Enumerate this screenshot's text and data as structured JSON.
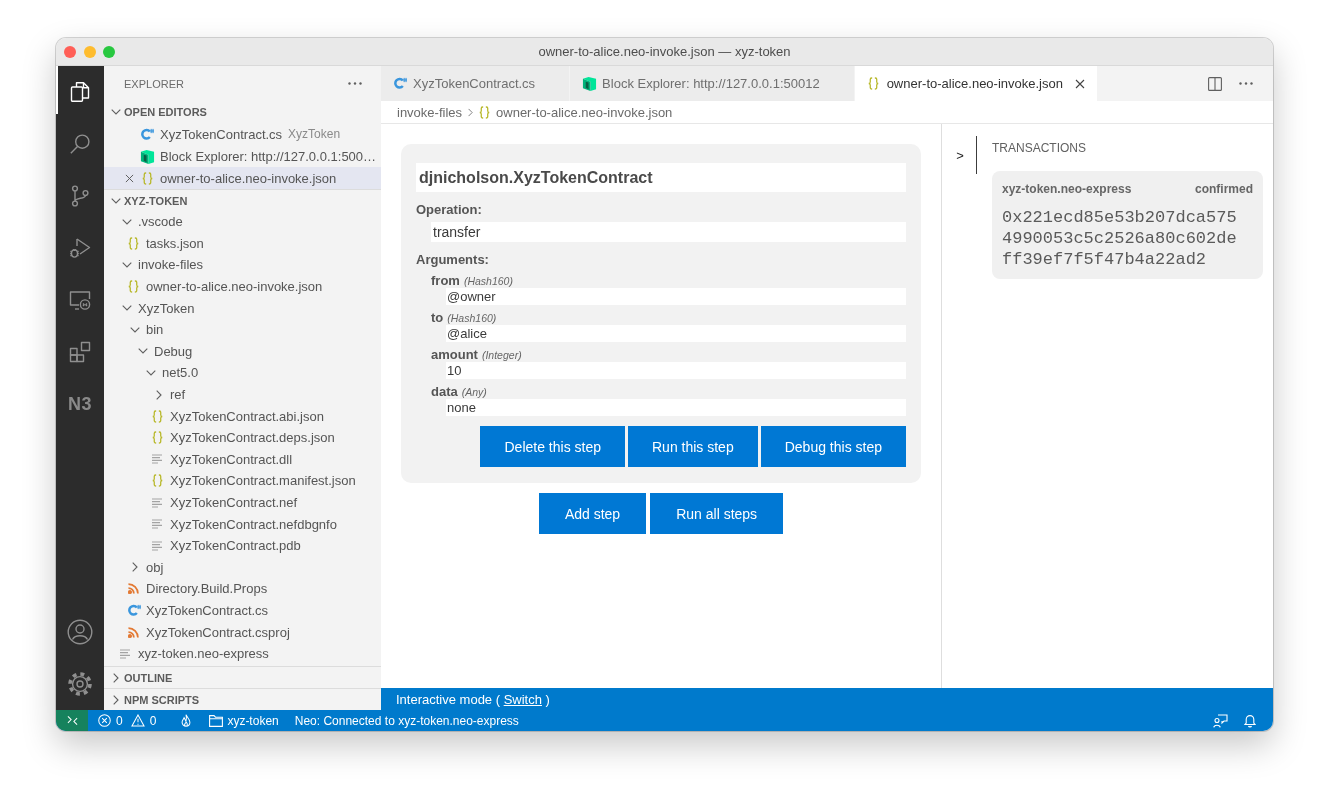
{
  "window": {
    "title": "owner-to-alice.neo-invoke.json — xyz-token"
  },
  "activity_bar": {
    "top": [
      {
        "kind": "files",
        "selected": true
      },
      {
        "kind": "search",
        "selected": false
      },
      {
        "kind": "source-control",
        "selected": false
      },
      {
        "kind": "run-debug",
        "selected": false
      },
      {
        "kind": "remote",
        "selected": false
      },
      {
        "kind": "extensions",
        "selected": false
      },
      {
        "kind": "text",
        "label": "N3",
        "selected": false
      }
    ],
    "bottom": [
      {
        "kind": "account"
      },
      {
        "kind": "settings"
      }
    ]
  },
  "sidebar": {
    "title": "EXPLORER",
    "open_editors": {
      "title": "OPEN EDITORS",
      "expanded": true,
      "items": [
        {
          "label": "XyzTokenContract.cs",
          "description": "XyzToken",
          "kind": "csharp",
          "selected": false
        },
        {
          "label": "Block Explorer: http://127.0.0.1:500…",
          "kind": "explorer",
          "selected": false
        },
        {
          "label": "owner-to-alice.neo-invoke.json",
          "kind": "json",
          "selected": true
        }
      ]
    },
    "folder": {
      "title": "XYZ-TOKEN",
      "expanded": true,
      "tree": [
        {
          "label": ".vscode",
          "kind": "folder",
          "expanded": true,
          "children": [
            {
              "label": "tasks.json",
              "kind": "json"
            }
          ]
        },
        {
          "label": "invoke-files",
          "kind": "folder",
          "expanded": true,
          "children": [
            {
              "label": "owner-to-alice.neo-invoke.json",
              "kind": "json"
            }
          ]
        },
        {
          "label": "XyzToken",
          "kind": "folder",
          "expanded": true,
          "children": [
            {
              "label": "bin",
              "kind": "folder",
              "expanded": true,
              "children": [
                {
                  "label": "Debug",
                  "kind": "folder",
                  "expanded": true,
                  "children": [
                    {
                      "label": "net5.0",
                      "kind": "folder",
                      "expanded": true,
                      "children": [
                        {
                          "label": "ref",
                          "kind": "folder",
                          "expanded": false
                        },
                        {
                          "label": "XyzTokenContract.abi.json",
                          "kind": "json"
                        },
                        {
                          "label": "XyzTokenContract.deps.json",
                          "kind": "json"
                        },
                        {
                          "label": "XyzTokenContract.dll",
                          "kind": "text"
                        },
                        {
                          "label": "XyzTokenContract.manifest.json",
                          "kind": "json"
                        },
                        {
                          "label": "XyzTokenContract.nef",
                          "kind": "text"
                        },
                        {
                          "label": "XyzTokenContract.nefdbgnfo",
                          "kind": "text"
                        },
                        {
                          "label": "XyzTokenContract.pdb",
                          "kind": "text"
                        }
                      ]
                    }
                  ]
                }
              ]
            },
            {
              "label": "obj",
              "kind": "folder",
              "expanded": false
            },
            {
              "label": "Directory.Build.Props",
              "kind": "xml"
            },
            {
              "label": "XyzTokenContract.cs",
              "kind": "csharp"
            },
            {
              "label": "XyzTokenContract.csproj",
              "kind": "xml"
            }
          ]
        },
        {
          "label": "xyz-token.neo-express",
          "kind": "text"
        }
      ]
    },
    "sections": [
      {
        "title": "OUTLINE",
        "expanded": false
      },
      {
        "title": "NPM SCRIPTS",
        "expanded": false
      }
    ]
  },
  "tabs": [
    {
      "label": "XyzTokenContract.cs",
      "kind": "csharp",
      "selected": false
    },
    {
      "label": "Block Explorer: http://127.0.0.1:50012",
      "kind": "explorer",
      "selected": false
    },
    {
      "label": "owner-to-alice.neo-invoke.json",
      "kind": "json",
      "selected": true
    }
  ],
  "breadcrumbs": [
    {
      "label": "invoke-files"
    },
    {
      "label": "owner-to-alice.neo-invoke.json",
      "kind": "json"
    }
  ],
  "invoke": {
    "contract": "djnicholson.XyzTokenContract",
    "operation_label": "Operation:",
    "operation": "transfer",
    "arguments_label": "Arguments:",
    "arguments": [
      {
        "name": "from",
        "type": "(Hash160)",
        "value": "@owner"
      },
      {
        "name": "to",
        "type": "(Hash160)",
        "value": "@alice"
      },
      {
        "name": "amount",
        "type": "(Integer)",
        "value": "10"
      },
      {
        "name": "data",
        "type": "(Any)",
        "value": "none"
      }
    ],
    "step_buttons": [
      "Delete this step",
      "Run this step",
      "Debug this step"
    ],
    "file_buttons": [
      "Add step",
      "Run all steps"
    ]
  },
  "transactions": {
    "toggle": ">",
    "title": "TRANSACTIONS",
    "items": [
      {
        "network": "xyz-token.neo-express",
        "status": "confirmed",
        "hash": "0x221ecd85e53b207dca5754990053c5c2526a80c602deff39ef7f5f47b4a22ad2"
      }
    ]
  },
  "mode_bar": {
    "text": "Interactive mode (",
    "link": "Switch",
    "text_after": ")"
  },
  "status_bar": {
    "problems": {
      "errors": "0",
      "warnings": "0"
    },
    "folder": "xyz-token",
    "connection": "Neo: Connected to xyz-token.neo-express"
  }
}
